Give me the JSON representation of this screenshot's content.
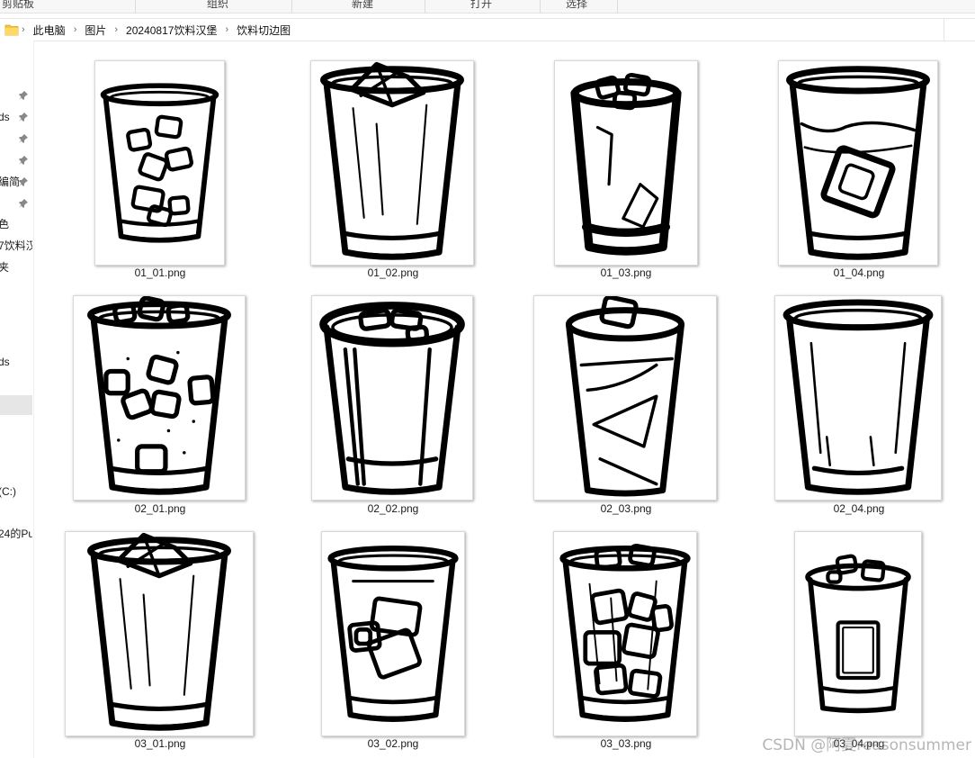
{
  "ribbon": {
    "groups": [
      "剪贴板",
      "组织",
      "新建",
      "打开",
      "选择"
    ]
  },
  "address": {
    "crumbs": [
      "此电脑",
      "图片",
      "20240817饮料汉堡",
      "饮料切边图"
    ]
  },
  "nav": {
    "items": [
      {
        "label": "",
        "pinned": true
      },
      {
        "label": "ds",
        "pinned": true
      },
      {
        "label": "",
        "pinned": true
      },
      {
        "label": "",
        "pinned": true
      },
      {
        "label": "编简",
        "pinned": true
      },
      {
        "label": "",
        "pinned": true
      },
      {
        "label": "色",
        "pinned": false
      },
      {
        "label": "7饮料汉",
        "pinned": false
      },
      {
        "label": "夹",
        "pinned": false
      },
      {
        "label": "ds",
        "pinned": false
      },
      {
        "label": "",
        "pinned": false,
        "selected": true
      },
      {
        "label": "(C:)",
        "pinned": false
      },
      {
        "label": "24的Pu",
        "pinned": false
      }
    ]
  },
  "files": [
    {
      "name": "01_01.png",
      "style": "cubes"
    },
    {
      "name": "01_02.png",
      "style": "wide-ice"
    },
    {
      "name": "01_03.png",
      "style": "tall-ice"
    },
    {
      "name": "01_04.png",
      "style": "liquid"
    },
    {
      "name": "02_01.png",
      "style": "bubbles"
    },
    {
      "name": "02_02.png",
      "style": "lid-ice"
    },
    {
      "name": "02_03.png",
      "style": "swirl"
    },
    {
      "name": "02_04.png",
      "style": "empty"
    },
    {
      "name": "03_01.png",
      "style": "wide-ice"
    },
    {
      "name": "03_02.png",
      "style": "blocks"
    },
    {
      "name": "03_03.png",
      "style": "full-ice"
    },
    {
      "name": "03_04.png",
      "style": "label-cup"
    }
  ],
  "watermark": "CSDN @阿夏reasonsummer"
}
